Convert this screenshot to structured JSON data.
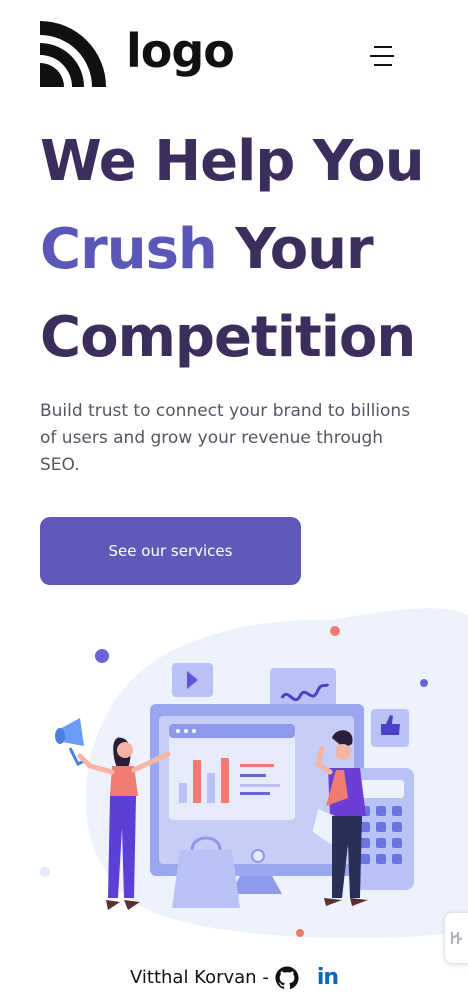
{
  "header": {
    "logo_text": "logo",
    "logo_icon": "signal-arcs-icon",
    "menu_icon": "hamburger-menu-icon"
  },
  "hero": {
    "title_line1": "We Help You",
    "title_accent": "Crush",
    "title_line2_rest": " Your",
    "title_line3": "Competition",
    "description": "Build trust to connect your brand to billions of users and grow your revenue through SEO.",
    "cta_label": "See our services"
  },
  "illustration": {
    "subject": "marketing-team-illustration"
  },
  "footer": {
    "author_text": "Vitthal Korvan -",
    "github_icon": "github-icon",
    "linkedin_label": "in"
  },
  "side_widget": {
    "icon": "widget-tab-icon"
  },
  "colors": {
    "heading": "#3b2d5c",
    "accent": "#5a57b8",
    "button": "#5f5ab8",
    "body_text": "#555566",
    "linkedin": "#0a66c2"
  }
}
